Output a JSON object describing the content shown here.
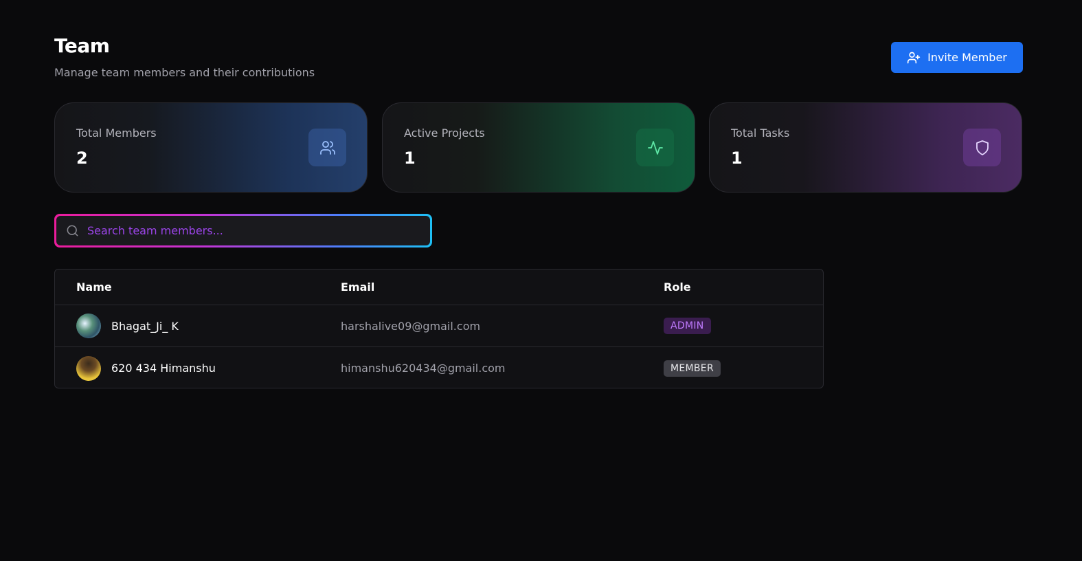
{
  "header": {
    "title": "Team",
    "subtitle": "Manage team members and their contributions",
    "invite_button_label": "Invite Member"
  },
  "stats": [
    {
      "label": "Total Members",
      "value": "2",
      "icon": "users-icon",
      "accent": "#3b82f6"
    },
    {
      "label": "Active Projects",
      "value": "1",
      "icon": "activity-icon",
      "accent": "#10b981"
    },
    {
      "label": "Total Tasks",
      "value": "1",
      "icon": "shield-icon",
      "accent": "#a855f7"
    }
  ],
  "search": {
    "placeholder": "Search team members...",
    "value": ""
  },
  "table": {
    "columns": [
      "Name",
      "Email",
      "Role"
    ],
    "rows": [
      {
        "name": "Bhagat_Ji_ K",
        "email": "harshalive09@gmail.com",
        "role": "ADMIN"
      },
      {
        "name": "620 434 Himanshu",
        "email": "himanshu620434@gmail.com",
        "role": "MEMBER"
      }
    ]
  },
  "colors": {
    "primary": "#1d6ff2",
    "background": "#0a0a0c",
    "admin_badge": "#c07bff",
    "member_badge": "#e4e4e7"
  }
}
